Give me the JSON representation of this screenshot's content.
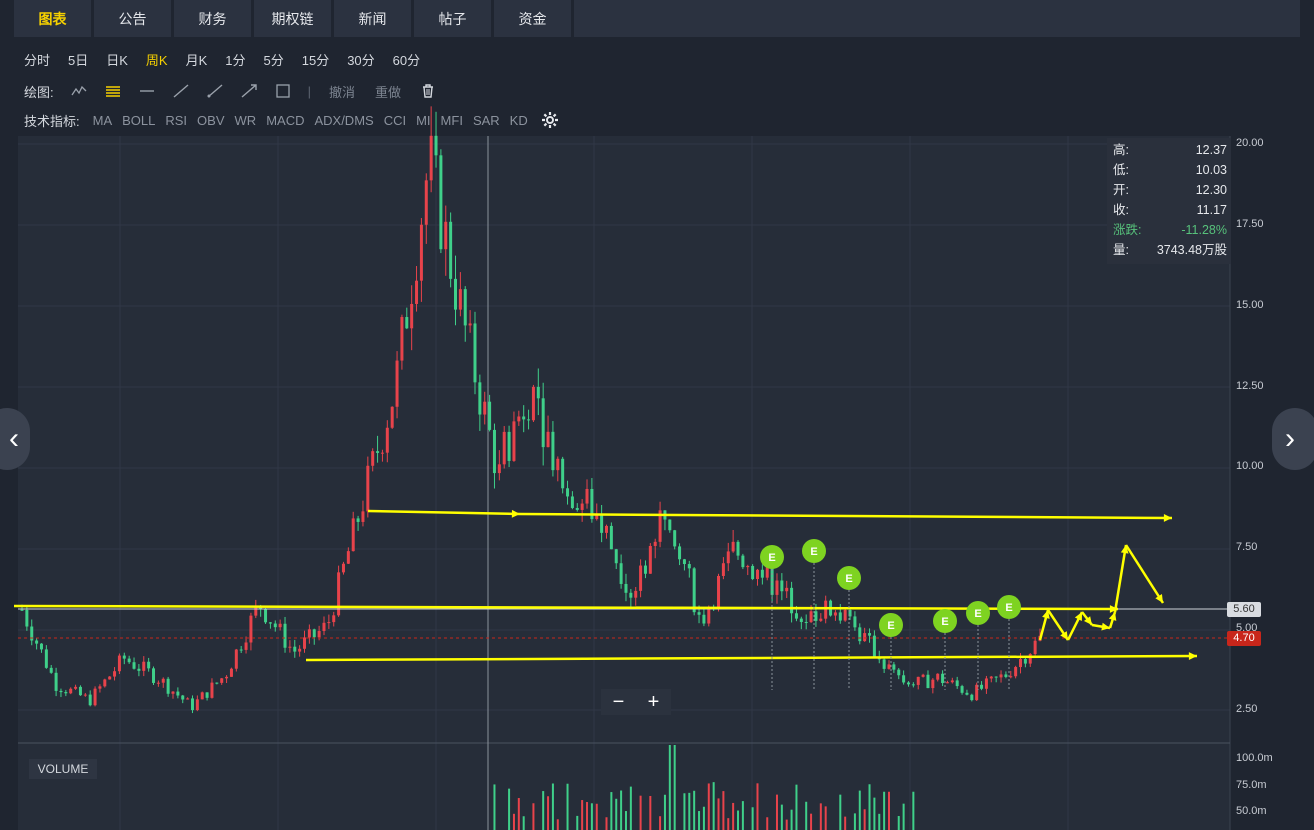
{
  "tabs": [
    {
      "label": "图表",
      "active": true
    },
    {
      "label": "公告"
    },
    {
      "label": "财务"
    },
    {
      "label": "期权链"
    },
    {
      "label": "新闻"
    },
    {
      "label": "帖子"
    },
    {
      "label": "资金"
    }
  ],
  "periods": [
    "分时",
    "5日",
    "日K",
    "周K",
    "月K",
    "1分",
    "5分",
    "15分",
    "30分",
    "60分"
  ],
  "active_period": "周K",
  "drawing": {
    "label": "绘图:",
    "tools": [
      "polyline-tool-icon",
      "horizontal-lines-tool-icon",
      "horizontal-line-tool-icon",
      "line-tool-icon",
      "ray-tool-icon",
      "arrow-line-tool-icon",
      "rectangle-tool-icon"
    ],
    "undo": "撤消",
    "redo": "重做",
    "trash_icon": "trash-icon"
  },
  "indicators": {
    "label": "技术指标:",
    "items": [
      "MA",
      "BOLL",
      "RSI",
      "OBV",
      "WR",
      "MACD",
      "ADX/DMS",
      "CCI",
      "MI",
      "MFI",
      "SAR",
      "KD"
    ],
    "settings_icon": "gear-icon"
  },
  "info_box": {
    "high_label": "高:",
    "high": "12.37",
    "low_label": "低:",
    "low": "10.03",
    "open_label": "开:",
    "open": "12.30",
    "close_label": "收:",
    "close": "11.17",
    "change_label": "涨跌:",
    "change": "-11.28%",
    "volume_label": "量:",
    "volume": "3743.48万股"
  },
  "price_axis": [
    "20.00",
    "17.50",
    "15.00",
    "12.50",
    "10.00",
    "7.50",
    "5.00",
    "2.50"
  ],
  "volume_axis": [
    "100.0m",
    "75.0m",
    "50.0m"
  ],
  "price_tags": {
    "level": "5.60",
    "last": "4.70"
  },
  "volume_label": "VOLUME",
  "event_marker": "E",
  "zoom": {
    "minus": "−",
    "plus": "+"
  },
  "colors": {
    "up": "#e8434b",
    "down": "#3fd08a",
    "annotation": "#ffff00",
    "event": "#7ed321",
    "accent": "#f5d000"
  },
  "chart_data": {
    "type": "candlestick",
    "title": "",
    "ylim": [
      1.5,
      20.5
    ],
    "yticks": [
      2.5,
      5,
      7.5,
      10,
      12.5,
      15,
      17.5,
      20
    ],
    "closes": [
      5.6,
      3.3,
      2.8,
      4.1,
      3.5,
      2.6,
      3.6,
      5.8,
      4.3,
      5.1,
      8.8,
      12.5,
      19.5,
      14.5,
      10.0,
      12.5,
      9.5,
      8.5,
      6.0,
      9.0,
      5.2,
      7.5,
      6.5,
      5.5,
      5.6,
      4.5,
      3.2,
      3.5,
      3.0,
      3.6,
      4.7
    ],
    "resistance_level": 5.6,
    "last_price": 4.7,
    "events": 7
  }
}
